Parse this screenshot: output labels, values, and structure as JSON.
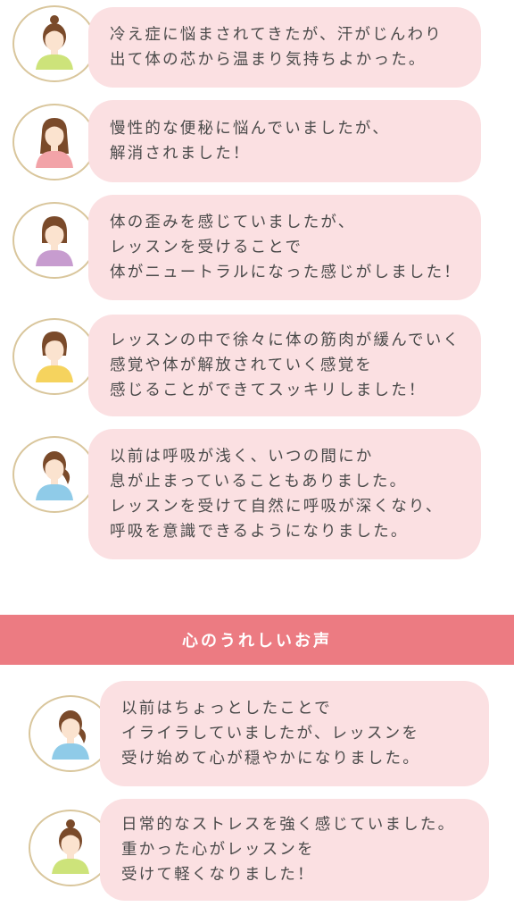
{
  "testimonials": [
    {
      "lines": [
        "冷え症に悩まされてきたが、汗がじんわり",
        "出て体の芯から温まり気持ちよかった。"
      ],
      "avatar_icon": "woman-bun-hair-icon",
      "shirt_color": "#cde37a"
    },
    {
      "lines": [
        "慢性的な便秘に悩んでいましたが、",
        "解消されました！"
      ],
      "avatar_icon": "woman-long-hair-icon",
      "shirt_color": "#f2a3a8"
    },
    {
      "lines": [
        "体の歪みを感じていましたが、",
        "レッスンを受けることで",
        "体がニュートラルになった感じがしました！"
      ],
      "avatar_icon": "woman-bob-hair-icon",
      "shirt_color": "#c79ccf"
    },
    {
      "lines": [
        "レッスンの中で徐々に体の筋肉が緩んでいく",
        "感覚や体が解放されていく感覚を",
        "感じることができてスッキリしました！"
      ],
      "avatar_icon": "woman-short-hair-icon",
      "shirt_color": "#f5d35e"
    },
    {
      "lines": [
        "以前は呼吸が浅く、いつの間にか",
        "息が止まっていることもありました。",
        "レッスンを受けて自然に呼吸が深くなり、",
        "呼吸を意識できるようになりました。"
      ],
      "avatar_icon": "woman-ponytail-icon",
      "shirt_color": "#8fcbe8"
    }
  ],
  "section": {
    "title": "心のうれしいお声",
    "band_color": "#ec7b82"
  },
  "heart_testimonials": [
    {
      "lines": [
        "以前はちょっとしたことで",
        "イライラしていましたが、レッスンを",
        "受け始めて心が穏やかになりました。"
      ],
      "avatar_icon": "woman-ponytail-icon",
      "shirt_color": "#8fcbe8"
    },
    {
      "lines": [
        "日常的なストレスを強く感じていました。",
        "重かった心がレッスンを",
        "受けて軽くなりました！"
      ],
      "avatar_icon": "woman-bun-hair-icon",
      "shirt_color": "#cde37a"
    }
  ],
  "colors": {
    "bubble": "#fbe0e2",
    "avatar_ring": "#d9c69c",
    "text": "#4a4a4a",
    "hair": "#7a4a2a",
    "skin": "#fbe3cf"
  }
}
